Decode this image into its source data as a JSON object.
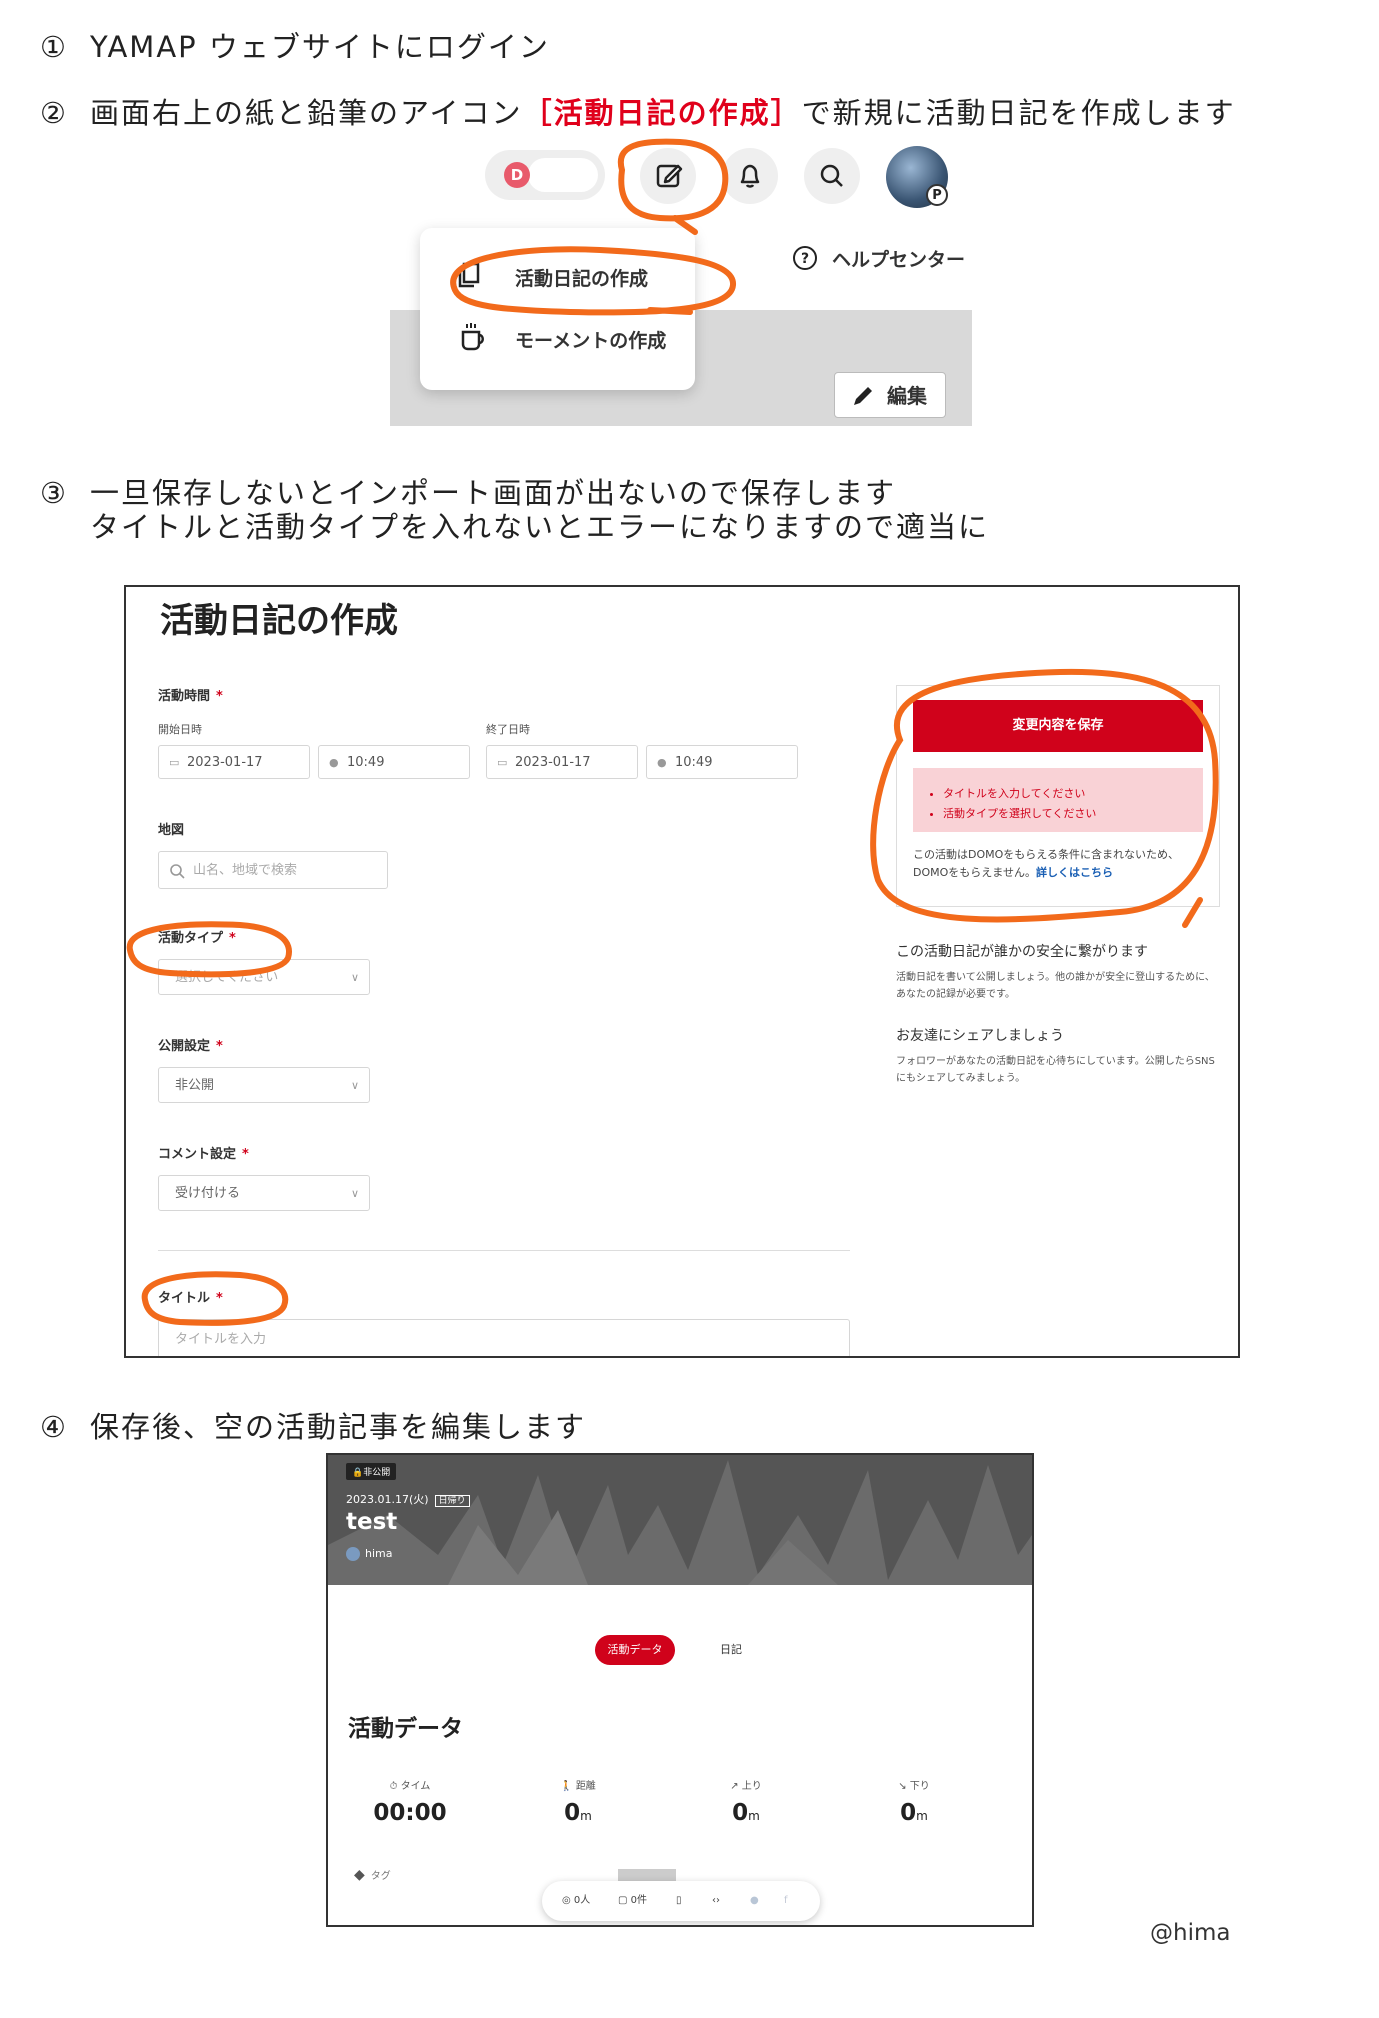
{
  "steps": {
    "s1_num": "①",
    "s1": "YAMAP ウェブサイトにログイン",
    "s2_num": "②",
    "s2_pre": "画面右上の紙と鉛筆のアイコン",
    "s2_hl": "［活動日記の作成］",
    "s2_post": "で新規に活動日記を作成します",
    "s3_num": "③",
    "s3_line1": "一旦保存しないとインポート画面が出ないので保存します",
    "s3_line2": "タイトルと活動タイプを入れないとエラーになりますので適当に",
    "s4_num": "④",
    "s4": "保存後、空の活動記事を編集します"
  },
  "header_menu": {
    "domo_label": "D",
    "avatar_badge": "P",
    "menu_create_diary": "活動日記の作成",
    "menu_create_moment": "モーメントの作成",
    "help_center": "ヘルプセンター",
    "edit_button": "編集"
  },
  "create_form": {
    "page_title": "活動日記の作成",
    "activity_time_label": "活動時間",
    "required_mark": "*",
    "start_label": "開始日時",
    "end_label": "終了日時",
    "start_date": "2023-01-17",
    "start_time": "10:49",
    "end_date": "2023-01-17",
    "end_time": "10:49",
    "map_label": "地図",
    "map_placeholder": "山名、地域で検索",
    "activity_type_label": "活動タイプ",
    "activity_type_placeholder": "選択してください",
    "visibility_label": "公開設定",
    "visibility_value": "非公開",
    "comment_label": "コメント設定",
    "comment_value": "受け付ける",
    "title_label": "タイトル",
    "title_placeholder": "タイトルを入力",
    "save_button": "変更内容を保存",
    "errors": [
      "タイトルを入力してください",
      "活動タイプを選択してください"
    ],
    "note_text": "この活動はDOMOをもらえる条件に含まれないため、DOMOをもらえません。",
    "note_link": "詳しくはこちら",
    "safety_heading": "この活動日記が誰かの安全に繋がります",
    "safety_text": "活動日記を書いて公開しましょう。他の誰かが安全に登山するために、あなたの記録が必要です。",
    "share_heading": "お友達にシェアしましょう",
    "share_text": "フォロワーがあなたの活動日記を心待ちにしています。公開したらSNSにもシェアしてみましょう。"
  },
  "diary_view": {
    "private_badge": "非公開",
    "date": "2023.01.17(火)",
    "day_trip_tag": "日帰り",
    "title": "test",
    "user": "hima",
    "tab_activity_data": "活動データ",
    "tab_diary": "日記",
    "section_title": "活動データ",
    "stats": [
      {
        "label": "タイム",
        "value": "00:00",
        "unit": ""
      },
      {
        "label": "距離",
        "value": "0",
        "unit": "m"
      },
      {
        "label": "上り",
        "value": "0",
        "unit": "m"
      },
      {
        "label": "下り",
        "value": "0",
        "unit": "m"
      }
    ],
    "tag_label": "タグ",
    "toolbar_domo": "0人",
    "toolbar_comments": "0件"
  },
  "credit": "@hima",
  "colors": {
    "accent": "#d0021b",
    "annotation": "#f26a1b"
  }
}
